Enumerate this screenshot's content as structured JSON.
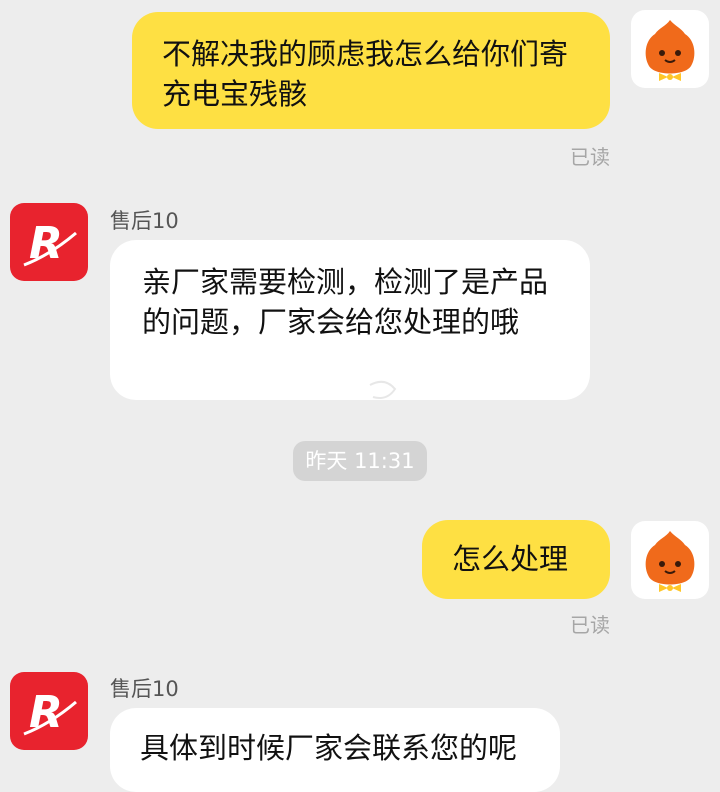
{
  "messages": [
    {
      "side": "out",
      "text": "不解决我的顾虑我怎么给你们寄充电宝残骸",
      "status": "已读"
    },
    {
      "side": "in",
      "sender": "售后10",
      "text": "亲厂家需要检测，检测了是产品的问题，厂家会给您处理的哦"
    },
    {
      "side": "out",
      "text": "怎么处理",
      "status": "已读"
    },
    {
      "side": "in",
      "sender": "售后10",
      "text": "具体到时候厂家会联系您的呢"
    }
  ],
  "time_divider": "昨天 11:31",
  "colors": {
    "background": "#ededed",
    "outgoing_bubble": "#fee043",
    "incoming_bubble": "#ffffff",
    "shop_avatar": "#e8232e",
    "user_avatar_face": "#f06a1b"
  },
  "icons": {
    "user_avatar": "orange-mascot-icon",
    "shop_avatar": "red-r-logo-icon"
  }
}
